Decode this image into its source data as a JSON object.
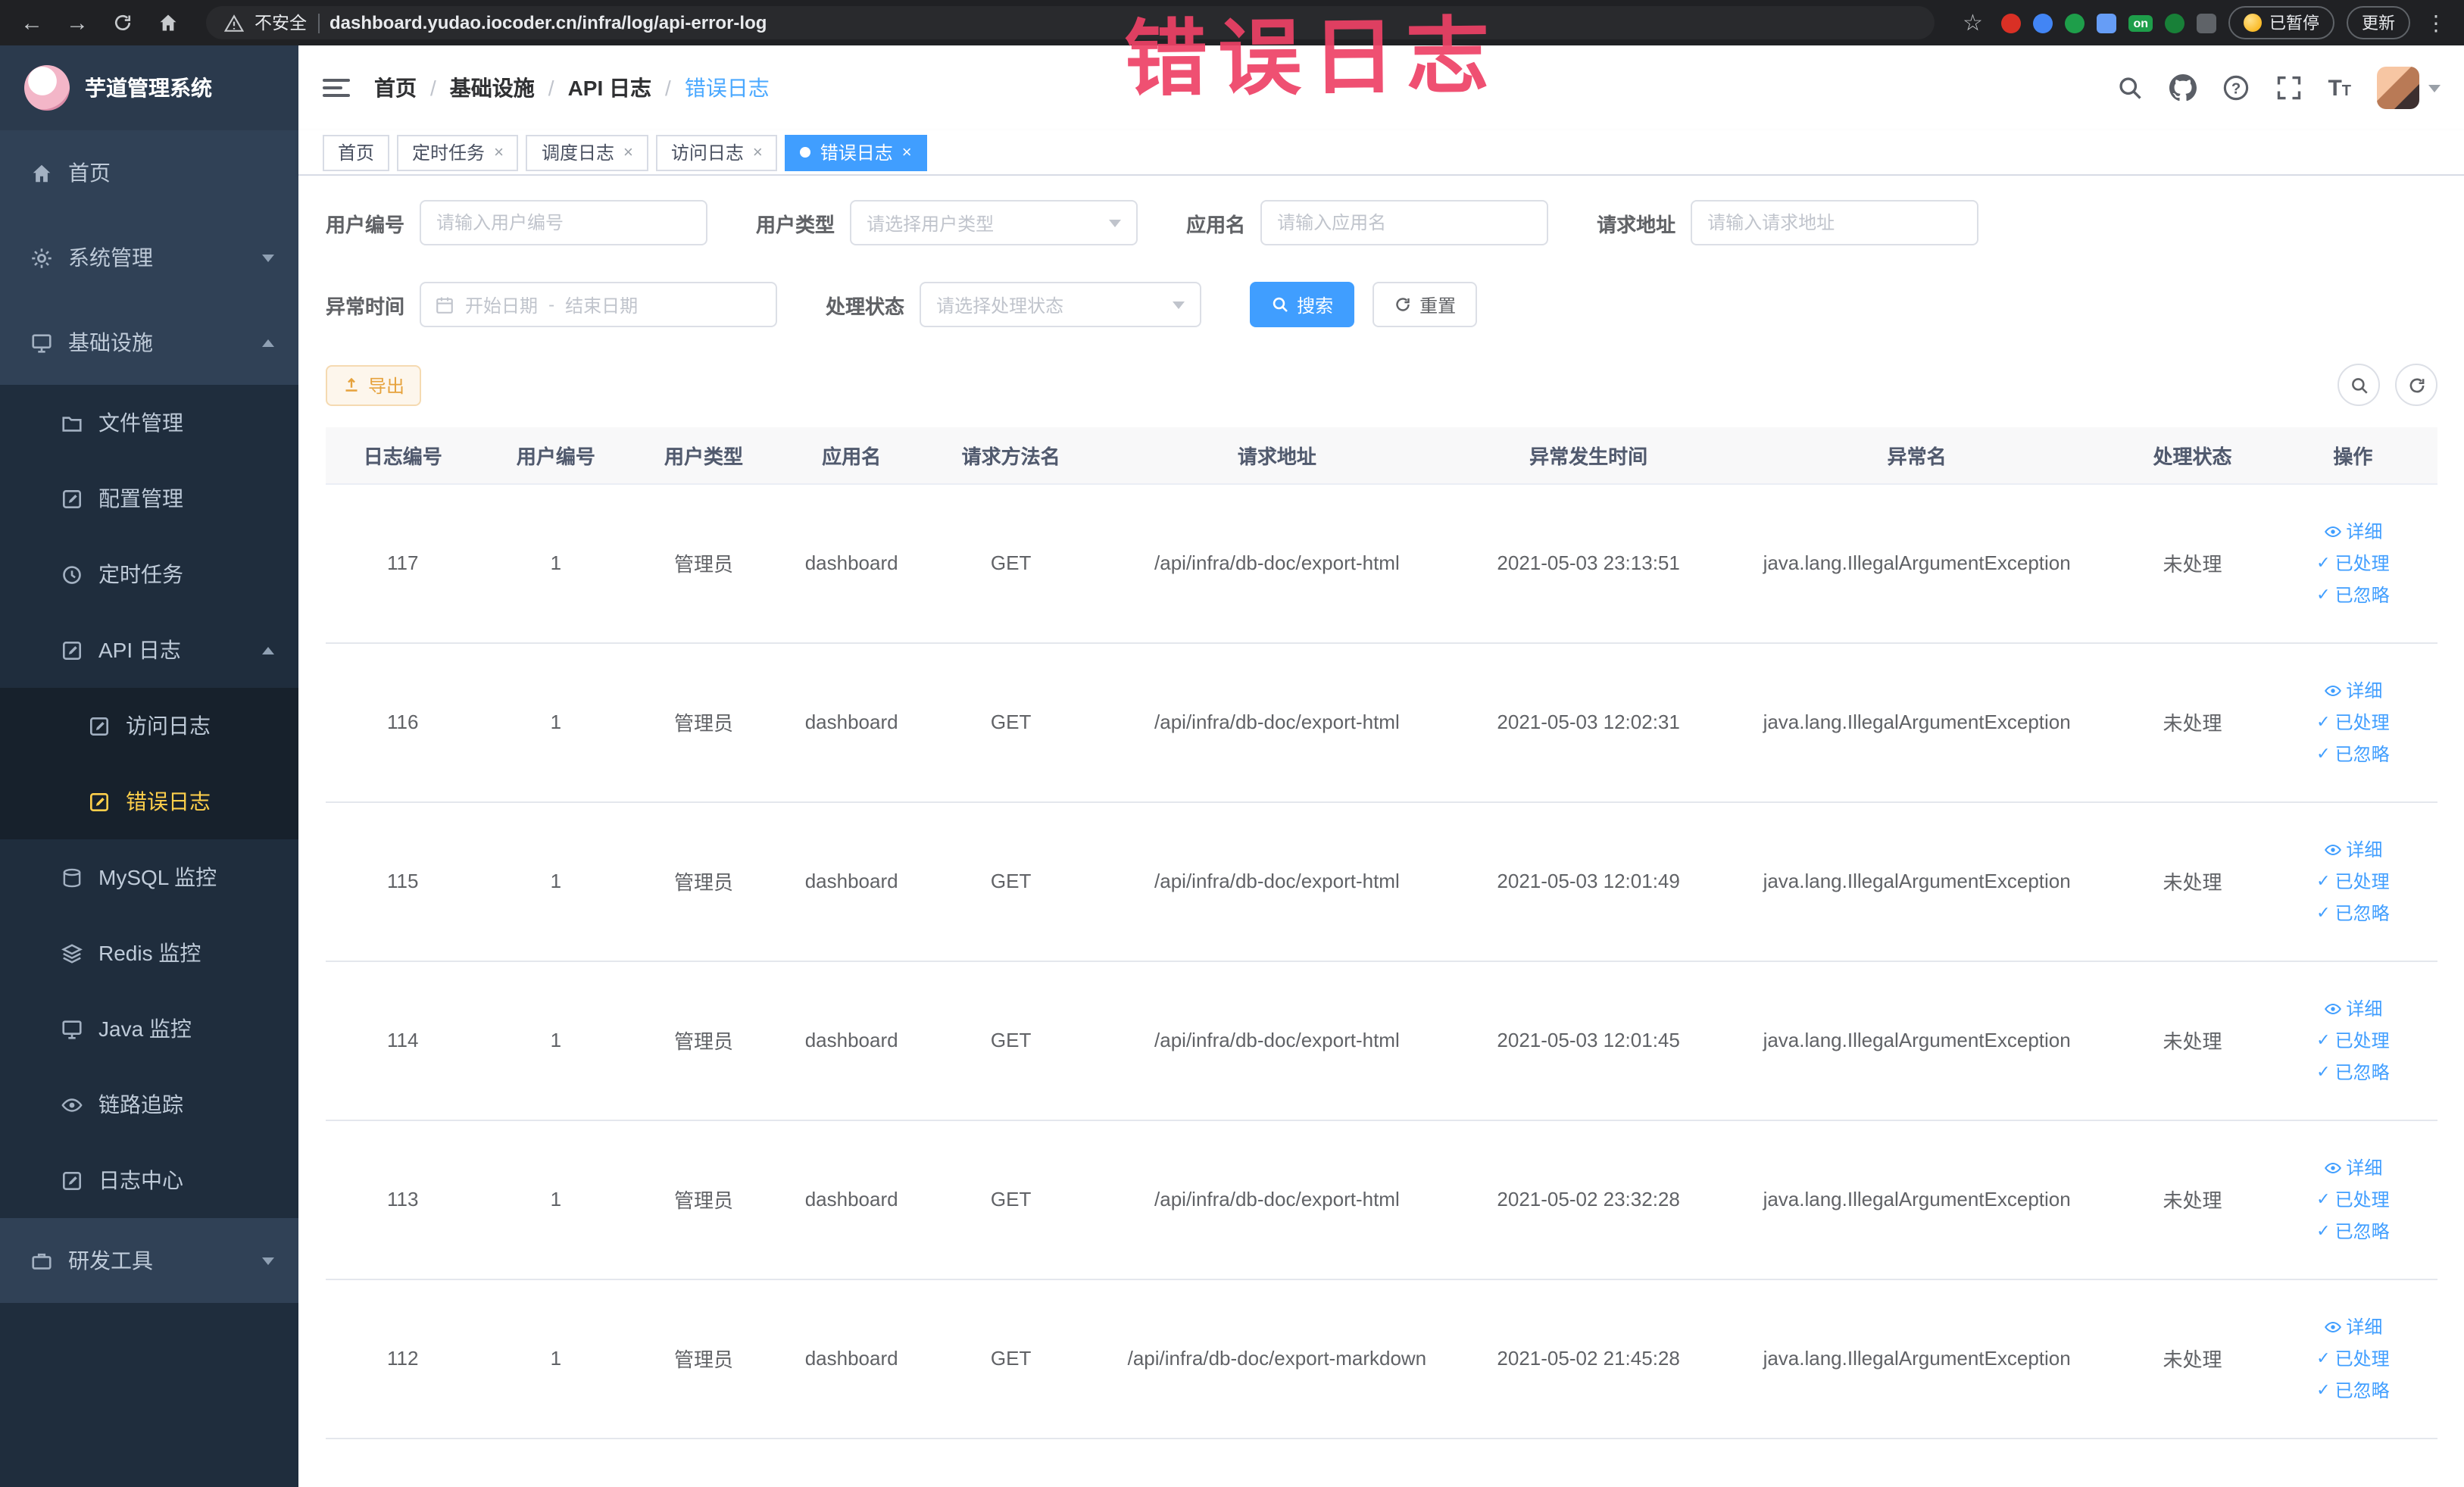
{
  "browser": {
    "security_label": "不安全",
    "url": "dashboard.yudao.iocoder.cn/infra/log/api-error-log",
    "paused_badge": "已暂停",
    "update_button": "更新",
    "extension_on_badge": "on"
  },
  "icons": {
    "back": "←",
    "forward": "→",
    "star": "☆",
    "more": "⋮",
    "close": "×",
    "check": "✓",
    "question": "?",
    "text_size": "T"
  },
  "annotation": {
    "text": "错误日志"
  },
  "sidebar": {
    "logo_title": "芋道管理系统",
    "items": [
      {
        "label": "首页"
      },
      {
        "label": "系统管理"
      },
      {
        "label": "基础设施"
      },
      {
        "label": "文件管理"
      },
      {
        "label": "配置管理"
      },
      {
        "label": "定时任务"
      },
      {
        "label": "API 日志"
      },
      {
        "label": "访问日志"
      },
      {
        "label": "错误日志"
      },
      {
        "label": "MySQL 监控"
      },
      {
        "label": "Redis 监控"
      },
      {
        "label": "Java 监控"
      },
      {
        "label": "链路追踪"
      },
      {
        "label": "日志中心"
      },
      {
        "label": "研发工具"
      }
    ]
  },
  "header": {
    "separator": "/",
    "breadcrumb": [
      "首页",
      "基础设施",
      "API 日志",
      "错误日志"
    ]
  },
  "tabs": [
    {
      "label": "首页"
    },
    {
      "label": "定时任务"
    },
    {
      "label": "调度日志"
    },
    {
      "label": "访问日志"
    },
    {
      "label": "错误日志"
    }
  ],
  "filters": {
    "user_id": {
      "label": "用户编号",
      "placeholder": "请输入用户编号"
    },
    "user_type": {
      "label": "用户类型",
      "placeholder": "请选择用户类型"
    },
    "app_name": {
      "label": "应用名",
      "placeholder": "请输入应用名"
    },
    "request_url": {
      "label": "请求地址",
      "placeholder": "请输入请求地址"
    },
    "exception_time": {
      "label": "异常时间",
      "start_placeholder": "开始日期",
      "separator": "-",
      "end_placeholder": "结束日期"
    },
    "process_status": {
      "label": "处理状态",
      "placeholder": "请选择处理状态"
    },
    "search_button": "搜索",
    "reset_button": "重置"
  },
  "toolbar": {
    "export_button": "导出"
  },
  "table": {
    "columns": [
      "日志编号",
      "用户编号",
      "用户类型",
      "应用名",
      "请求方法名",
      "请求地址",
      "异常发生时间",
      "异常名",
      "处理状态",
      "操作"
    ],
    "actions": [
      "详细",
      "已处理",
      "已忽略"
    ],
    "rows": [
      {
        "id": "117",
        "user_id": "1",
        "user_type": "管理员",
        "app": "dashboard",
        "method": "GET",
        "url": "/api/infra/db-doc/export-html",
        "time": "2021-05-03 23:13:51",
        "exception": "java.lang.IllegalArgumentException",
        "status": "未处理"
      },
      {
        "id": "116",
        "user_id": "1",
        "user_type": "管理员",
        "app": "dashboard",
        "method": "GET",
        "url": "/api/infra/db-doc/export-html",
        "time": "2021-05-03 12:02:31",
        "exception": "java.lang.IllegalArgumentException",
        "status": "未处理"
      },
      {
        "id": "115",
        "user_id": "1",
        "user_type": "管理员",
        "app": "dashboard",
        "method": "GET",
        "url": "/api/infra/db-doc/export-html",
        "time": "2021-05-03 12:01:49",
        "exception": "java.lang.IllegalArgumentException",
        "status": "未处理"
      },
      {
        "id": "114",
        "user_id": "1",
        "user_type": "管理员",
        "app": "dashboard",
        "method": "GET",
        "url": "/api/infra/db-doc/export-html",
        "time": "2021-05-03 12:01:45",
        "exception": "java.lang.IllegalArgumentException",
        "status": "未处理"
      },
      {
        "id": "113",
        "user_id": "1",
        "user_type": "管理员",
        "app": "dashboard",
        "method": "GET",
        "url": "/api/infra/db-doc/export-html",
        "time": "2021-05-02 23:32:28",
        "exception": "java.lang.IllegalArgumentException",
        "status": "未处理"
      },
      {
        "id": "112",
        "user_id": "1",
        "user_type": "管理员",
        "app": "dashboard",
        "method": "GET",
        "url": "/api/infra/db-doc/export-markdown",
        "time": "2021-05-02 21:45:28",
        "exception": "java.lang.IllegalArgumentException",
        "status": "未处理"
      }
    ]
  }
}
